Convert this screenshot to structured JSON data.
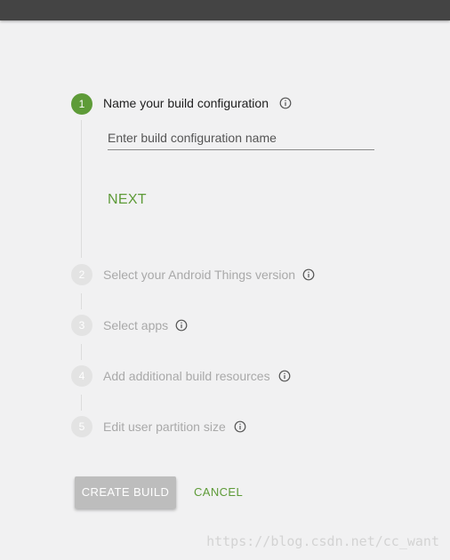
{
  "steps": [
    {
      "number": "1",
      "title": "Name your build configuration",
      "state": "active",
      "icon": "info-icon"
    },
    {
      "number": "2",
      "title": "Select your Android Things version",
      "state": "inactive",
      "icon": "info-icon"
    },
    {
      "number": "3",
      "title": "Select apps",
      "state": "inactive",
      "icon": "info-icon"
    },
    {
      "number": "4",
      "title": "Add additional build resources",
      "state": "inactive",
      "icon": "info-icon"
    },
    {
      "number": "5",
      "title": "Edit user partition size",
      "state": "inactive",
      "icon": "info-icon"
    }
  ],
  "build_name_input": {
    "placeholder": "Enter build configuration name",
    "value": ""
  },
  "next_label": "NEXT",
  "actions": {
    "create_label": "CREATE BUILD",
    "cancel_label": "CANCEL"
  },
  "watermark": "https://blog.csdn.net/cc_want",
  "colors": {
    "accent": "#5e9b38",
    "inactive_circle": "#e3e3e3",
    "inactive_text": "#a9a9a9",
    "disabled_button": "#bdbdbd",
    "top_bar": "#444444"
  }
}
